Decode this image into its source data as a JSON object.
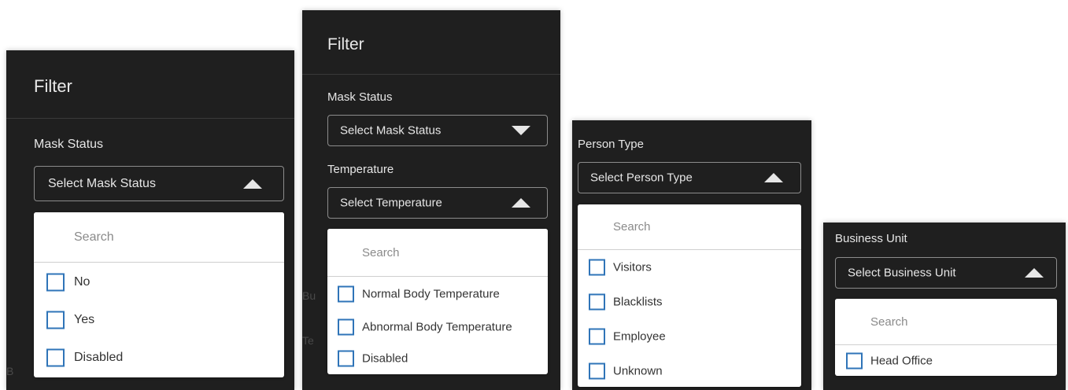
{
  "panel1": {
    "title": "Filter",
    "mask_label": "Mask Status",
    "mask_select": "Select Mask Status",
    "search_placeholder": "Search",
    "options": [
      "No",
      "Yes",
      "Disabled"
    ]
  },
  "panel2": {
    "title": "Filter",
    "mask_label": "Mask Status",
    "mask_select": "Select Mask Status",
    "temp_label": "Temperature",
    "temp_select": "Select Temperature",
    "search_placeholder": "Search",
    "options": [
      "Normal Body Temperature",
      "Abnormal Body Temperature",
      "Disabled"
    ]
  },
  "panel3": {
    "label": "Person Type",
    "select": "Select Person Type",
    "search_placeholder": "Search",
    "options": [
      "Visitors",
      "Blacklists",
      "Employee",
      "Unknown"
    ]
  },
  "panel4": {
    "label": "Business Unit",
    "select": "Select Business Unit",
    "search_placeholder": "Search",
    "options": [
      "Head Office"
    ]
  },
  "colors": {
    "panel_bg": "#1f1f1f",
    "dropdown_bg": "#ffffff",
    "checkbox_border": "#2f74b8",
    "text_light": "#e6e6e6"
  },
  "icons": {
    "dropdown_open": "triangle-up-icon",
    "dropdown_closed": "triangle-down-icon",
    "checkbox": "checkbox-empty-icon"
  }
}
